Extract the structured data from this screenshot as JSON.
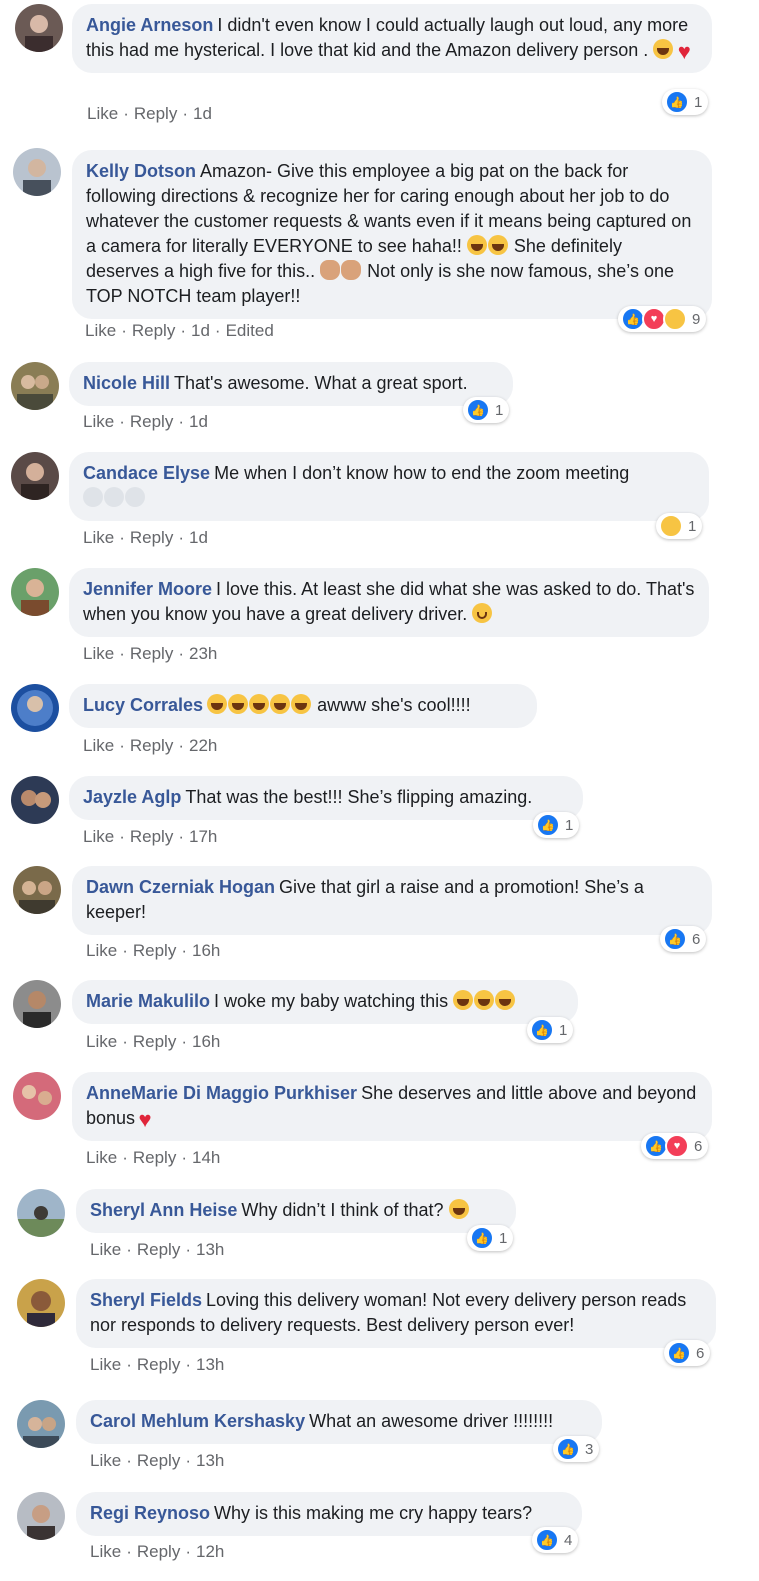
{
  "colors": {
    "author": "#385898",
    "bubble": "#f0f2f5",
    "meta": "#65676b",
    "like": "#1877f2",
    "love": "#f33e58",
    "haha": "#f7c443"
  },
  "actions": {
    "like": "Like",
    "reply": "Reply",
    "sep": "·"
  },
  "comments": [
    {
      "author": "Angie Arneson",
      "text": "I didn't even know I could actually laugh out loud, any more this had me hysterical. I love that kid and the Amazon delivery person .",
      "emojis_after": [
        "laugh-icon",
        "heart-icon"
      ],
      "time": "1d",
      "edited": "",
      "reactions": [
        "like"
      ],
      "count": "1"
    },
    {
      "author": "Kelly Dotson",
      "text": "Amazon- Give this employee a big pat on the back for following directions & recognize her for caring enough about her job to do whatever the customer requests & wants even if it means being captured on a camera for literally EVERYONE to see haha!!",
      "text2": "She definitely deserves a high five for this..",
      "text3": "Not only is she now famous, she’s one TOP NOTCH team player!!",
      "time": "1d",
      "edited": "Edited",
      "reactions": [
        "like",
        "love",
        "haha"
      ],
      "count": "9"
    },
    {
      "author": "Nicole Hill",
      "text": "That's awesome. What a great sport.",
      "time": "1d",
      "edited": "",
      "reactions": [
        "like"
      ],
      "count": "1"
    },
    {
      "author": "Candace Elyse",
      "text": "Me when I don’t know how to end the zoom meeting",
      "time": "1d",
      "edited": "",
      "reactions": [
        "haha"
      ],
      "count": "1"
    },
    {
      "author": "Jennifer Moore",
      "text": "I love this. At least she did what she was asked to do. That's when you know you have a great delivery driver.",
      "time": "23h",
      "edited": "",
      "reactions": [],
      "count": ""
    },
    {
      "author": "Lucy Corrales",
      "text": "awww she's cool!!!!",
      "time": "22h",
      "edited": "",
      "reactions": [],
      "count": ""
    },
    {
      "author": "Jayzle Aglp",
      "text": "That was the best!!! She’s flipping amazing.",
      "time": "17h",
      "edited": "",
      "reactions": [
        "like"
      ],
      "count": "1"
    },
    {
      "author": "Dawn Czerniak Hogan",
      "text": "Give that girl a raise and a promotion! She’s a keeper!",
      "time": "16h",
      "edited": "",
      "reactions": [
        "like"
      ],
      "count": "6"
    },
    {
      "author": "Marie Makulilo",
      "text": "I woke my baby watching this",
      "time": "16h",
      "edited": "",
      "reactions": [
        "like"
      ],
      "count": "1"
    },
    {
      "author": "AnneMarie Di Maggio Purkhiser",
      "text": "She deserves and little above and beyond bonus",
      "time": "14h",
      "edited": "",
      "reactions": [
        "like",
        "love"
      ],
      "count": "6"
    },
    {
      "author": "Sheryl Ann Heise",
      "text": "Why didn’t I think of that?",
      "time": "13h",
      "edited": "",
      "reactions": [
        "like"
      ],
      "count": "1"
    },
    {
      "author": "Sheryl Fields",
      "text": "Loving this delivery woman! Not every delivery person reads nor responds to delivery requests. Best delivery person ever!",
      "time": "13h",
      "edited": "",
      "reactions": [
        "like"
      ],
      "count": "6"
    },
    {
      "author": "Carol Mehlum Kershasky",
      "text": "What an awesome driver !!!!!!!!",
      "time": "13h",
      "edited": "",
      "reactions": [
        "like"
      ],
      "count": "3"
    },
    {
      "author": "Regi Reynoso",
      "text": "Why is this making me cry happy tears?",
      "time": "12h",
      "edited": "",
      "reactions": [
        "like"
      ],
      "count": "4"
    }
  ]
}
